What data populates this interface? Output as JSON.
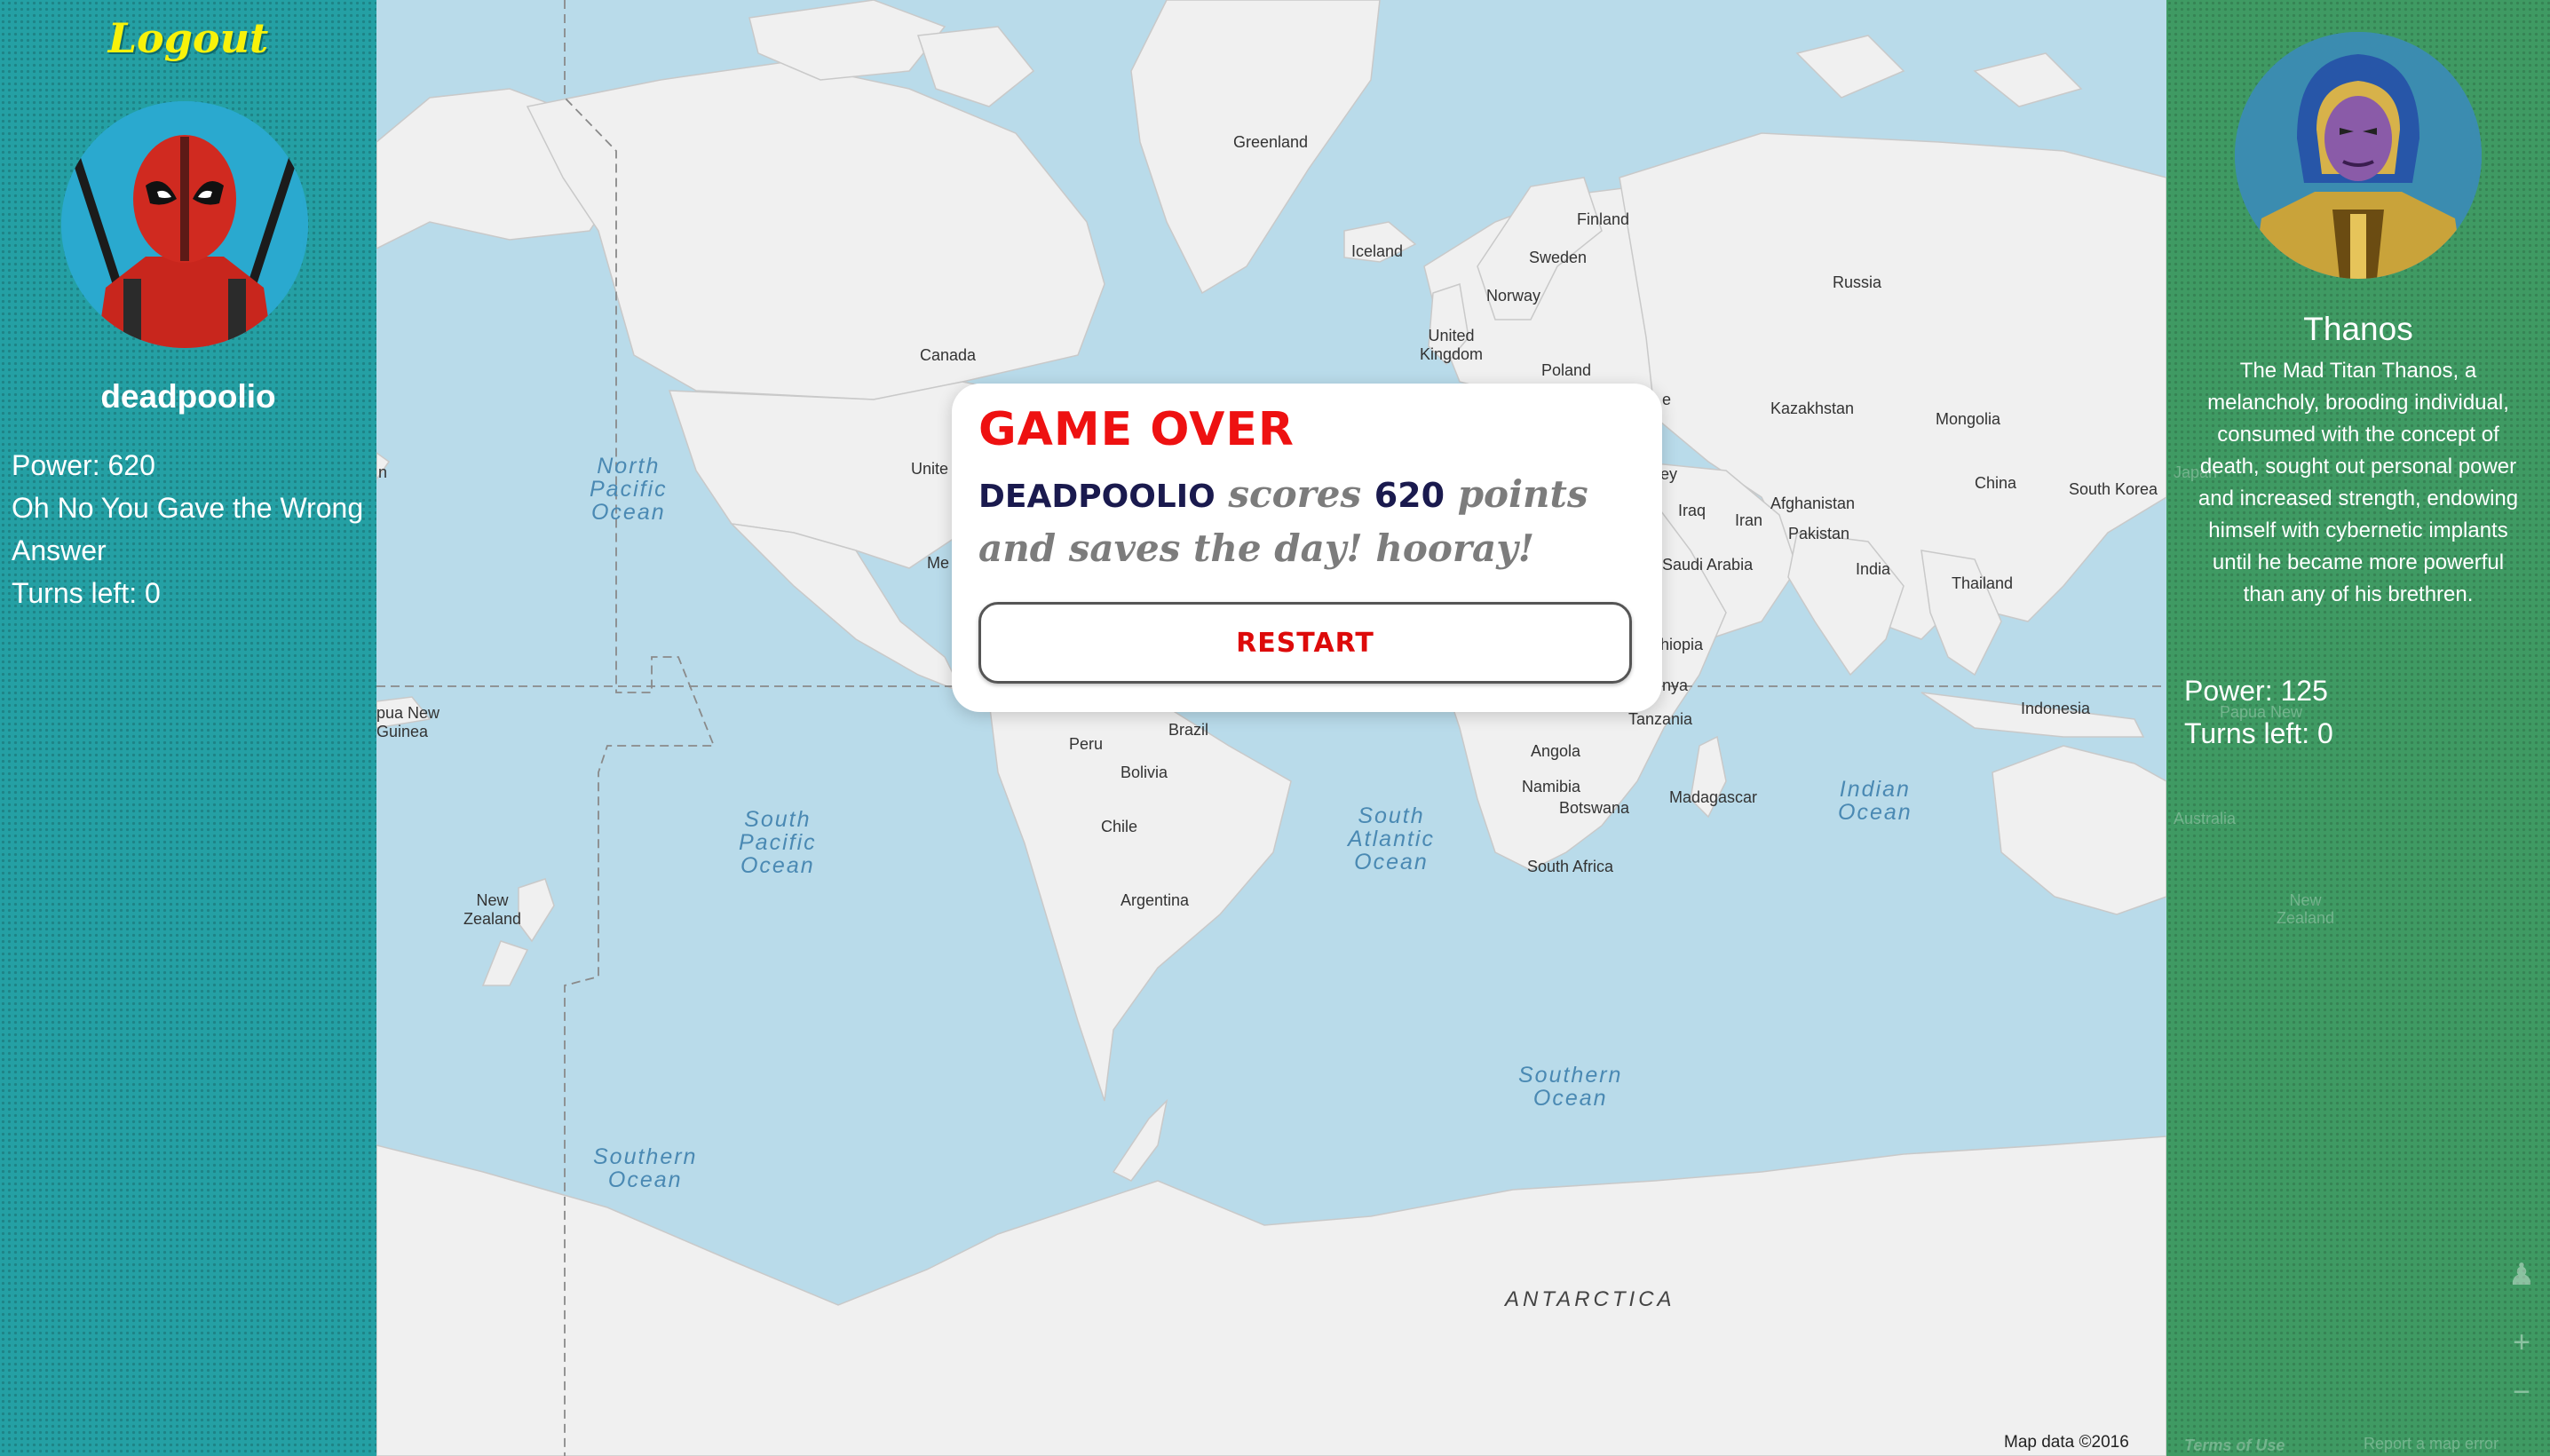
{
  "left_panel": {
    "logout_label": "Logout",
    "player": {
      "name": "deadpoolio",
      "power_line": "Power: 620",
      "status_message": "Oh No You Gave the Wrong Answer",
      "turns_line": "Turns left: 0"
    }
  },
  "right_panel": {
    "opponent": {
      "name": "Thanos",
      "bio": "The Mad Titan Thanos, a melancholy, brooding individual, consumed with the concept of death, sought out personal power and increased strength, endowing himself with cybernetic implants until he became more powerful than any of his brethren.",
      "power_line": "Power: 125",
      "turns_line": "Turns left: 0"
    },
    "map_ghost": {
      "papua": "Papua New",
      "japan": "Japan",
      "australia": "Australia",
      "nz": "New\nZealand",
      "terms": "Terms of Use",
      "report": "Report a map error"
    }
  },
  "modal": {
    "title": "GAME OVER",
    "player_name": "DEADPOOLIO",
    "text_scores": "scores",
    "score": "620",
    "text_rest": "points and saves the day! hooray!",
    "restart_label": "RESTART"
  },
  "map": {
    "countries": {
      "greenland": "Greenland",
      "iceland": "Iceland",
      "finland": "Finland",
      "sweden": "Sweden",
      "norway": "Norway",
      "russia": "Russia",
      "canada": "Canada",
      "united_kingdom": "United\nKingdom",
      "poland": "Poland",
      "kazakhstan": "Kazakhstan",
      "mongolia": "Mongolia",
      "china": "China",
      "south_korea": "South Korea",
      "japan": "Japan",
      "afghanistan": "Afghanistan",
      "iraq": "Iraq",
      "iran": "Iran",
      "pakistan": "Pakistan",
      "india": "India",
      "thailand": "Thailand",
      "saudi_arabia": "Saudi Arabia",
      "ethiopia": "hiopia",
      "kenya": "nya",
      "tanzania": "Tanzania",
      "indonesia": "Indonesia",
      "angola": "Angola",
      "namibia": "Namibia",
      "botswana": "Botswana",
      "south_africa": "South Africa",
      "madagascar": "Madagascar",
      "brazil": "Brazil",
      "peru": "Peru",
      "bolivia": "Bolivia",
      "chile": "Chile",
      "argentina": "Argentina",
      "united_states_partial": "Unite",
      "mexico_partial": "Me",
      "turkey_partial": "ey",
      "papua_new_guinea": "pua New\nGuinea",
      "new_zealand": "New\nZealand",
      "japan_edge": "n"
    },
    "oceans": {
      "north_pacific": "North\nPacific\nOcean",
      "south_pacific": "South\nPacific\nOcean",
      "south_atlantic": "South\nAtlantic\nOcean",
      "indian": "Indian\nOcean",
      "southern_center": "Southern\nOcean",
      "southern_left": "Southern\nOcean"
    },
    "antarctica": "ANTARCTICA",
    "attribution": "Map data ©2016"
  },
  "colors": {
    "left_panel_bg": "#24a0a4",
    "right_panel_bg": "#3f9a63",
    "logout": "#f8f20a",
    "title_red": "#ee1111",
    "ocean": "#b9dbea",
    "land": "#efefef"
  }
}
